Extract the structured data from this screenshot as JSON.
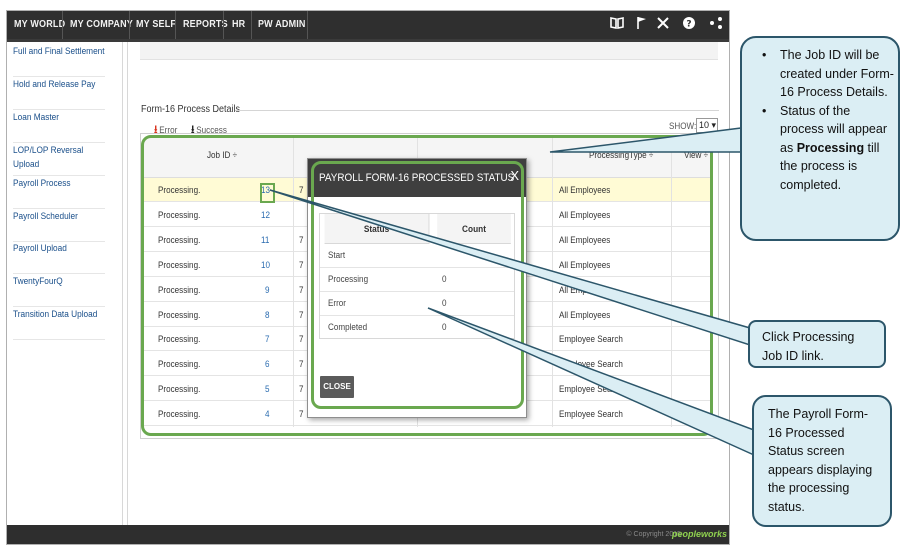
{
  "nav": {
    "items": [
      "MY WORLD",
      "MY COMPANY",
      "MY SELF",
      "REPORTS",
      "HR",
      "PW ADMIN"
    ],
    "icons": [
      "book-icon",
      "flag-icon",
      "tools-icon",
      "help-icon",
      "share-icon"
    ]
  },
  "sidebar": {
    "items": [
      "Full and Final Settlement",
      "Hold and Release Pay",
      "Loan Master",
      "LOP/LOP Reversal Upload",
      "Payroll Process",
      "Payroll Scheduler",
      "Payroll Upload",
      "TwentyFourQ",
      "Transition Data Upload"
    ]
  },
  "section": {
    "title": "Form-16 Process Details",
    "legend_error": "Error",
    "legend_success": "Success",
    "show_label": "SHOW:",
    "show_value": "10"
  },
  "table": {
    "headers": {
      "job_id": "Job ID ÷",
      "processing_type": "ProcessingType ÷",
      "view": "View ÷"
    },
    "rows": [
      {
        "status": "Processing.",
        "job_id": "13",
        "date_prefix": "7",
        "processing_type": "All Employees"
      },
      {
        "status": "Processing.",
        "job_id": "12",
        "date_prefix": "",
        "processing_type": "All Employees"
      },
      {
        "status": "Processing.",
        "job_id": "11",
        "date_prefix": "7",
        "processing_type": "All Employees"
      },
      {
        "status": "Processing.",
        "job_id": "10",
        "date_prefix": "7",
        "processing_type": "All Employees"
      },
      {
        "status": "Processing.",
        "job_id": "9",
        "date_prefix": "7",
        "processing_type": "All Employees"
      },
      {
        "status": "Processing.",
        "job_id": "8",
        "date_prefix": "7",
        "processing_type": "All Employees"
      },
      {
        "status": "Processing.",
        "job_id": "7",
        "date_prefix": "7",
        "processing_type": "Employee Search"
      },
      {
        "status": "Processing.",
        "job_id": "6",
        "date_prefix": "7",
        "processing_type": "Employee Search"
      },
      {
        "status": "Processing.",
        "job_id": "5",
        "date_prefix": "7",
        "processing_type": "Employee Search"
      },
      {
        "status": "Processing.",
        "job_id": "4",
        "date_prefix": "7",
        "processing_type": "Employee Search"
      }
    ]
  },
  "modal": {
    "title": "PAYROLL FORM-16 PROCESSED STATUS",
    "close_x": "X",
    "col_status": "Status",
    "col_count": "Count",
    "rows": [
      {
        "status": "Start",
        "count": ""
      },
      {
        "status": "Processing",
        "count": "0"
      },
      {
        "status": "Error",
        "count": "0"
      },
      {
        "status": "Completed",
        "count": "0"
      }
    ],
    "close_button": "CLOSE"
  },
  "footer": {
    "copyright": "© Copyright 2015",
    "brand": "peopleworks"
  },
  "callouts": {
    "job_id_note": [
      "The Job ID will be created under Form-16 Process Details.",
      "Status of the process will appear as Processing till the process is completed."
    ],
    "job_id_note_2_prefix": "Status of the process will appear as ",
    "job_id_note_2_bold": "Processing",
    "job_id_note_2_suffix": " till the process is completed.",
    "click_note": "Click Processing Job ID link.",
    "status_screen_note": "The Payroll Form-16 Processed Status screen appears displaying the processing status."
  }
}
